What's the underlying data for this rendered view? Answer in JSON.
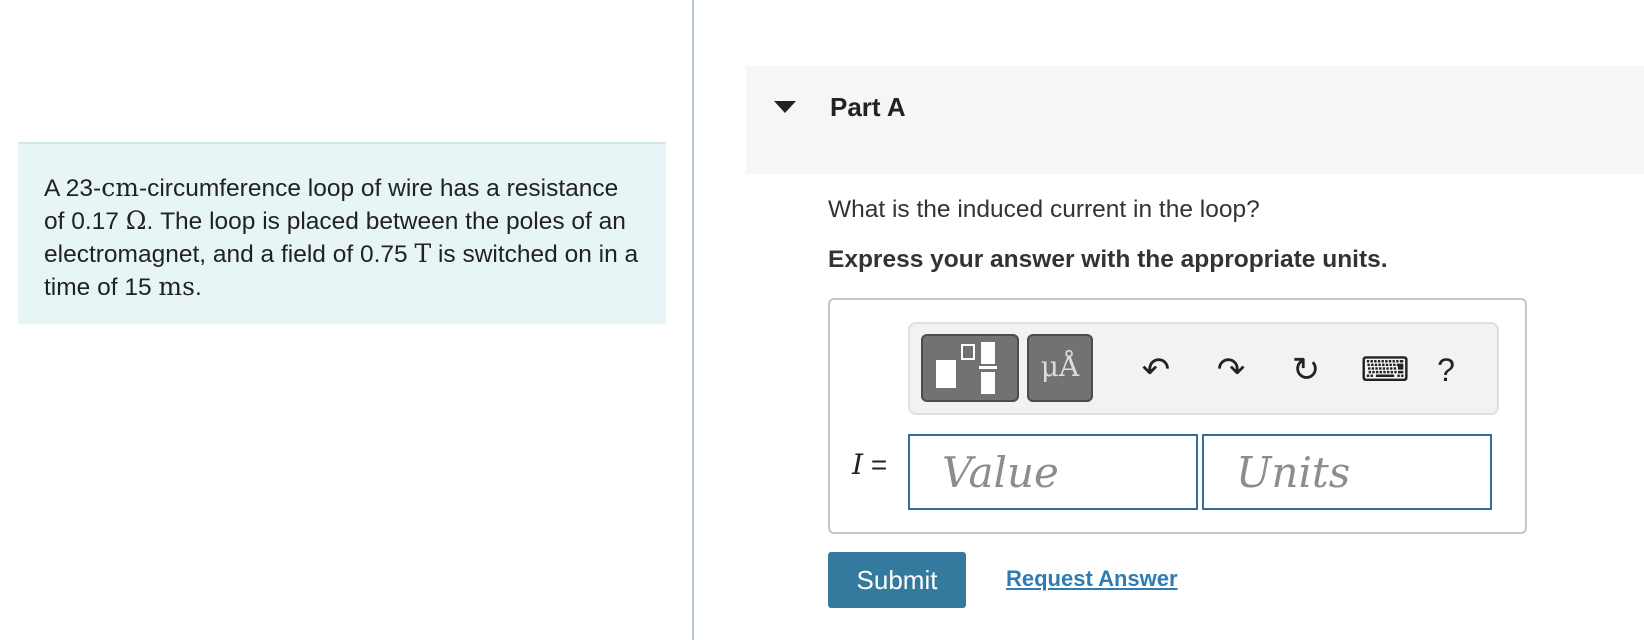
{
  "problem": {
    "p1": "A 23-",
    "m1": "cm",
    "p2": "-circumference loop of wire has a resistance of 0.17 ",
    "m2": "Ω",
    "p3": ". The loop is placed between the poles of an electromagnet, and a field of 0.75 ",
    "m3": "T",
    "p4": " is switched on in a time of 15 ",
    "m4": "ms",
    "p5": "."
  },
  "part": {
    "title": "Part A",
    "question": "What is the induced current in the loop?",
    "instruction": "Express your answer with the appropriate units."
  },
  "toolbar": {
    "symbols_label": "μÅ",
    "undo": "↶",
    "redo": "↷",
    "reset": "↻",
    "keyboard": "⌨",
    "help": "?"
  },
  "answer": {
    "variable": "I",
    "equals": " =",
    "value_placeholder": "Value",
    "units_placeholder": "Units"
  },
  "actions": {
    "submit": "Submit",
    "request_answer": "Request Answer"
  }
}
